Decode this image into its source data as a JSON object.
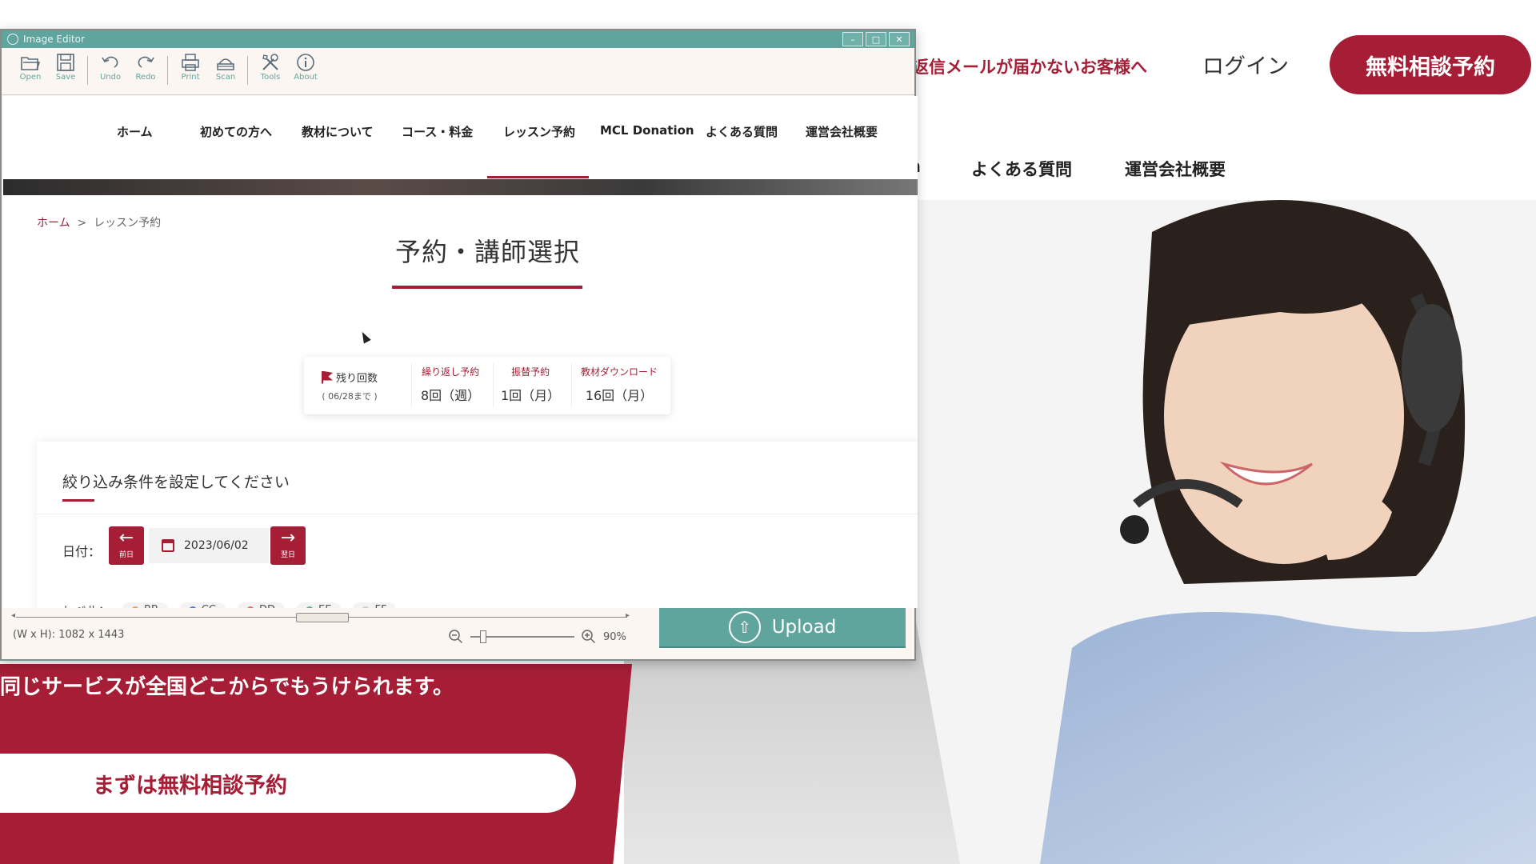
{
  "background_site": {
    "email_notice": "返信メールが届かないお客様へ",
    "login": "ログイン",
    "cta_top": "無料相談予約",
    "nav_items": [
      "n",
      "よくある質問",
      "運営会社概要"
    ],
    "tagline": "同じサービスが全国どこからでもうけられます。",
    "cta_bottom": "まずは無料相談予約",
    "accent_color": "#a51e36"
  },
  "editor": {
    "title": "Image Editor",
    "window_controls": [
      "–",
      "□",
      "✕"
    ],
    "toolbar": [
      {
        "label": "Open",
        "icon": "folder-open-icon"
      },
      {
        "label": "Save",
        "icon": "save-icon"
      },
      {
        "label": "Undo",
        "icon": "undo-icon"
      },
      {
        "label": "Redo",
        "icon": "redo-icon"
      },
      {
        "label": "Print",
        "icon": "print-icon"
      },
      {
        "label": "Scan",
        "icon": "scan-icon"
      },
      {
        "label": "Tools",
        "icon": "tools-icon"
      },
      {
        "label": "About",
        "icon": "info-icon"
      }
    ],
    "dimensions": "(W x H): 1082 x 1443",
    "zoom": "90%",
    "upload_label": "Upload",
    "accent_color": "#5fa59e"
  },
  "webpage": {
    "nav": [
      "ホーム",
      "初めての方へ",
      "教材について",
      "コース・料金",
      "レッスン予約",
      "MCL Donation",
      "よくある質問",
      "運営会社概要"
    ],
    "active_nav": "レッスン予約",
    "breadcrumb": {
      "home": "ホーム",
      "separator": ">",
      "current": "レッスン予約"
    },
    "heading": "予約・講師選択",
    "stats": {
      "remaining_label": "残り回数",
      "remaining_sub": "( 06/28まで )",
      "recurring_label": "繰り返し予約",
      "recurring_value": "8回（週）",
      "makeup_label": "振替予約",
      "makeup_value": "1回（月）",
      "download_label": "教材ダウンロード",
      "download_value": "16回（月）"
    },
    "filter": {
      "title": "絞り込み条件を設定してください",
      "date_label": "日付：",
      "prev_label": "前日",
      "next_label": "翌日",
      "date_value": "2023/06/02",
      "level_label": "レベル：",
      "levels": [
        {
          "name": "BB",
          "color": "#e8a26a"
        },
        {
          "name": "CC",
          "color": "#4a7fd0"
        },
        {
          "name": "DD",
          "color": "#e07070"
        },
        {
          "name": "EE",
          "color": "#5fb08a"
        },
        {
          "name": "FF",
          "color": "#cccccc"
        }
      ]
    }
  }
}
